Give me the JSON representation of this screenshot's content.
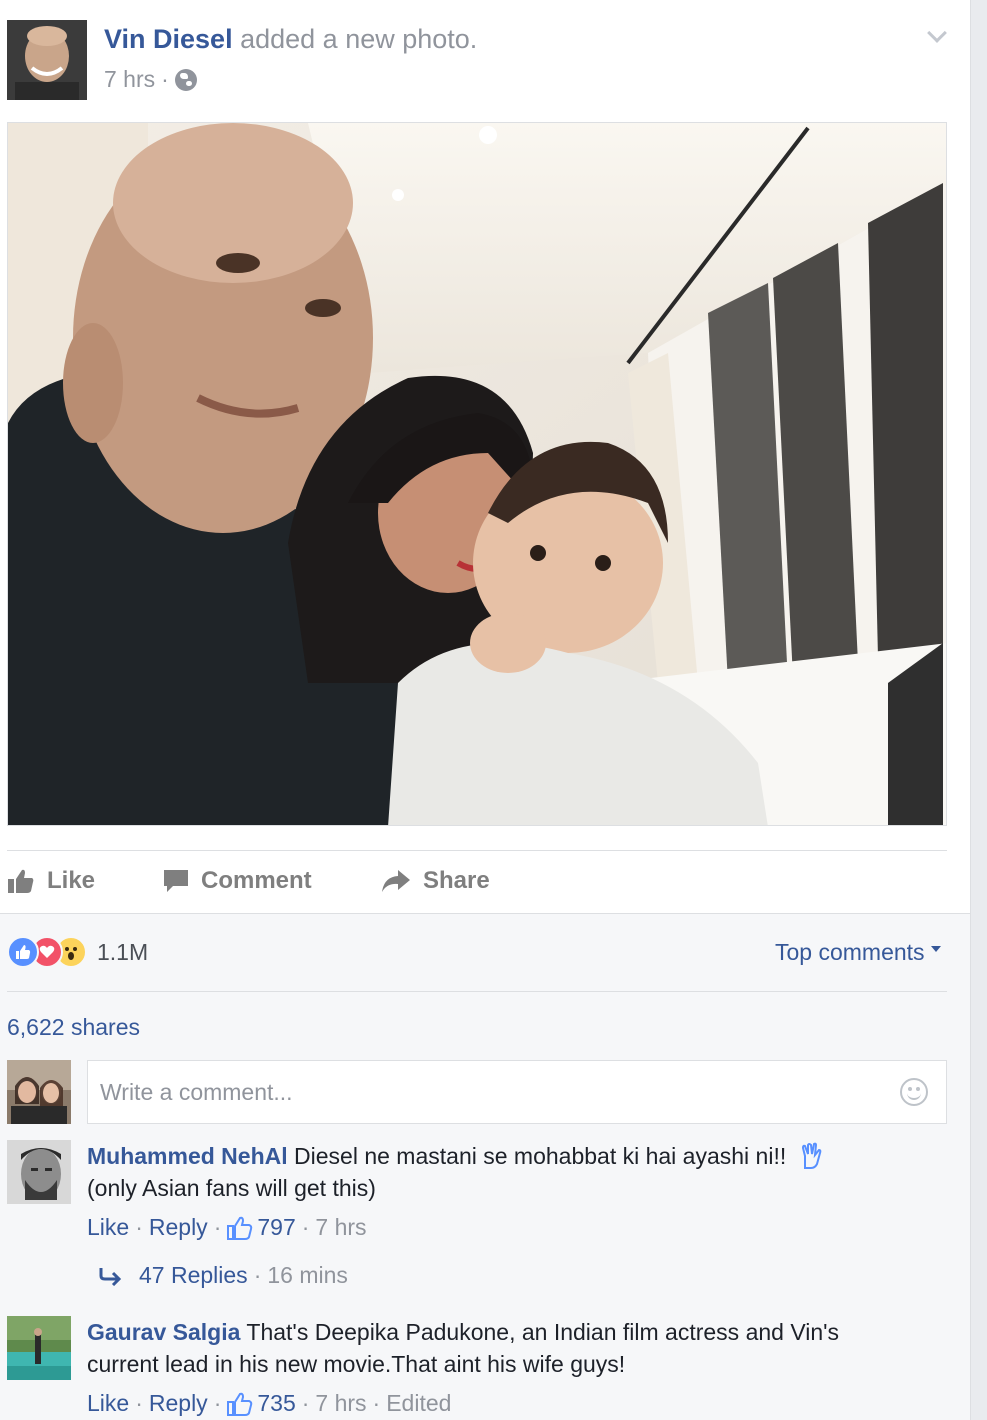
{
  "post": {
    "author": "Vin Diesel",
    "action_text": "added a new photo.",
    "time": "7 hrs",
    "time_separator": "·"
  },
  "actions": {
    "like_label": "Like",
    "comment_label": "Comment",
    "share_label": "Share"
  },
  "stats": {
    "reactions_count": "1.1M",
    "reaction_types": [
      "like",
      "love",
      "wow"
    ],
    "shares_label": "6,622 shares",
    "sort_label": "Top comments"
  },
  "composer": {
    "placeholder": "Write a comment..."
  },
  "comments": [
    {
      "name": "Muhammed NehAl",
      "text": "Diesel ne mastani se mohabbat ki hai ayashi ni!!",
      "text_line2": "(only Asian fans will get this)",
      "like_label": "Like",
      "reply_label": "Reply",
      "likes": "797",
      "time": "7 hrs",
      "replies_label": "47 Replies",
      "replies_time": "16 mins"
    },
    {
      "name": "Gaurav Salgia",
      "text": "That's Deepika Padukone, an Indian film actress and Vin's current lead in his new movie.That aint his wife guys!",
      "like_label": "Like",
      "reply_label": "Reply",
      "likes": "735",
      "time": "7 hrs",
      "edited_label": "Edited"
    }
  ],
  "colors": {
    "link": "#365899",
    "muted": "#90949c",
    "like_blue": "#5890ff",
    "love_red": "#f25268",
    "wow_yellow": "#fcd35b"
  },
  "icons": {
    "privacy": "globe-icon",
    "menu": "chevron-down-icon",
    "like": "thumbs-up-icon",
    "comment": "speech-bubble-icon",
    "share": "share-arrow-icon",
    "composer_emoji": "smiley-icon",
    "reply_arrow": "reply-arrow-icon",
    "prayer": "raised-hand-icon"
  }
}
